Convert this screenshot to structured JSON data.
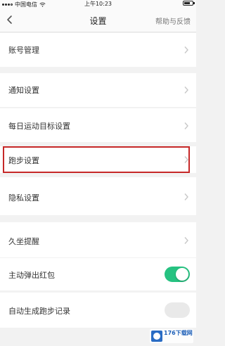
{
  "status_bar": {
    "carrier": "中国电信",
    "time": "上午10:23"
  },
  "nav": {
    "title": "设置",
    "help": "帮助与反馈"
  },
  "settings": {
    "account": "账号管理",
    "notifications": "通知设置",
    "daily_goal": "每日运动目标设置",
    "running": "跑步设置",
    "privacy": "隐私设置",
    "sedentary": "久坐提醒",
    "auto_red_packet": "主动弹出红包",
    "auto_run_record": "自动生成跑步记录"
  },
  "toggles": {
    "auto_red_packet_on": true,
    "auto_run_record_on": false
  },
  "colors": {
    "toggle_on": "#26c281",
    "highlight_border": "#c62828"
  },
  "watermark": {
    "text": "176下载网"
  }
}
